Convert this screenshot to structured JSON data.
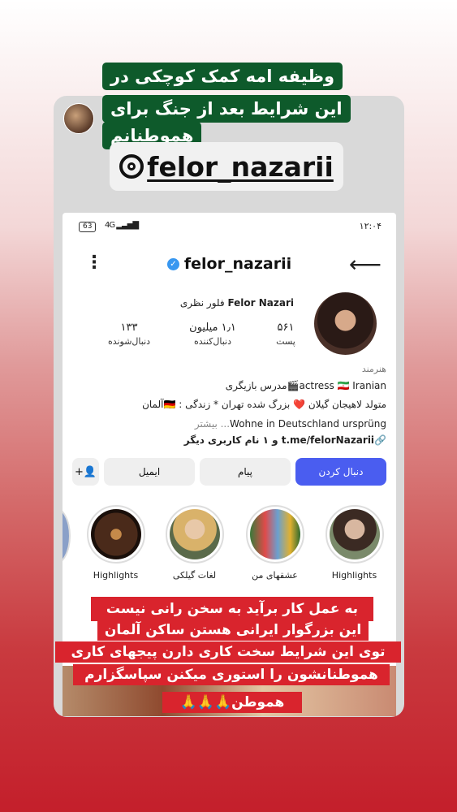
{
  "caption_top": {
    "line1": "وظیفه امه کمک کوچکی در",
    "line2": "این شرایط بعد از جنگ برای",
    "line3": "هموطنانم"
  },
  "mention": {
    "handle": "felor_nazarii"
  },
  "status_bar": {
    "battery": "63",
    "network": "4G",
    "time": "۱۲:۰۴"
  },
  "profile": {
    "username": "felor_nazarii",
    "full_name_en": "Felor Nazari",
    "full_name_fa": "فلور نظری",
    "stats": [
      {
        "value": "۵۶۱",
        "label": "پست"
      },
      {
        "value": "۱٫۱ میلیون",
        "label": "دنبال‌کننده"
      },
      {
        "value": "۱۳۳",
        "label": "دنبال‌شونده"
      }
    ],
    "category": "هنرمند",
    "bio_line1": "actress 🇮🇷 Iranian🎬مدرس بازیگری",
    "bio_line2": "متولد لاهیجان گیلان ❤️ بزرگ شده تهران * زندگی : 🇩🇪آلمان",
    "bio_line3": "Wohne in Deutschland ursprüng",
    "bio_more": "... بیشتر",
    "link": "t.me/felorNazarii",
    "link_suffix": "و ۱ نام کاربری دیگر"
  },
  "buttons": {
    "follow": "دنبال کردن",
    "message": "پیام",
    "email": "ایمیل",
    "add_user": "+👤"
  },
  "highlights": [
    {
      "label": "Highlights"
    },
    {
      "label": "عشقهای من"
    },
    {
      "label": "لغات گیلکی"
    },
    {
      "label": "Highlights"
    }
  ],
  "caption_bottom": {
    "line1": "به عمل کار برآید به سخن رانی نیست",
    "line2": "این بزرگوار ایرانی هستن ساکن آلمان",
    "line3": "توی این شرایط سخت کاری دارن پیجهای کاری",
    "line4": "هموطنانشون را استوری میکنن سپاسگزارم",
    "line5": "هموطن🙏🙏🙏"
  },
  "colors": {
    "follow_button": "#4a5df0",
    "caption_green": "#0e5a2b",
    "caption_red": "#d9242d"
  }
}
